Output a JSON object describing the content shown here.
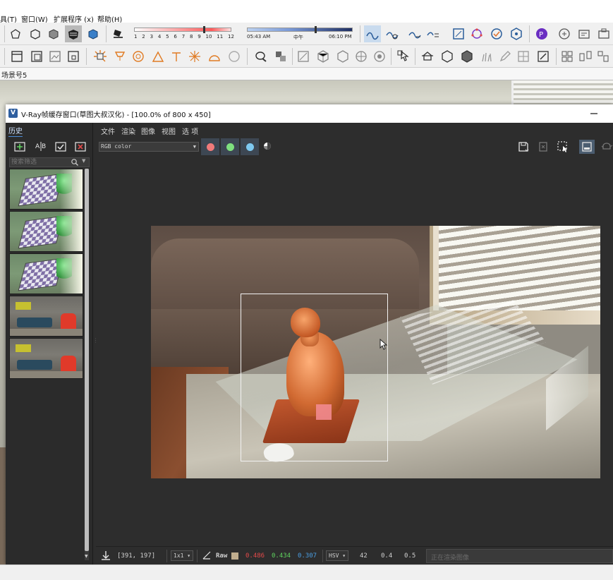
{
  "sketchup": {
    "menus": [
      {
        "id": "tools",
        "label": "具(T)"
      },
      {
        "id": "window",
        "label": "窗口(W)"
      },
      {
        "id": "extensions",
        "label": "扩展程序 (x)"
      },
      {
        "id": "help",
        "label": "帮助(H)"
      }
    ],
    "shadow_months": [
      "1",
      "2",
      "3",
      "4",
      "5",
      "6",
      "7",
      "8",
      "9",
      "10",
      "11",
      "12"
    ],
    "shadow_time_start": "05:43 AM",
    "shadow_time_mid": "中午",
    "shadow_time_end": "06:10 PM",
    "scene_tab": "场景号5"
  },
  "vfb": {
    "title": "V-Ray帧缓存窗口(草图大叔汉化) - [100.0% of 800 x 450]",
    "logo_glyph": "V",
    "history_label": "历史",
    "search_placeholder": "搜索筛选",
    "menus": [
      {
        "id": "file",
        "label": "文件"
      },
      {
        "id": "render",
        "label": "渲染"
      },
      {
        "id": "image",
        "label": "图像"
      },
      {
        "id": "view",
        "label": "视图"
      },
      {
        "id": "options",
        "label": "选 项"
      }
    ],
    "channel": "RGB color",
    "channel_colors": {
      "red": "#f07a7a",
      "green": "#7ee07e",
      "blue": "#7ec9f0"
    },
    "history_thumbs": [
      {
        "kind": "tex"
      },
      {
        "kind": "tex"
      },
      {
        "kind": "tex"
      },
      {
        "kind": "room"
      },
      {
        "kind": "room"
      }
    ],
    "status": {
      "coords": "[391, 197]",
      "sample_size": "1x1",
      "mode": "Raw",
      "r": "0.486",
      "g": "0.434",
      "b": "0.307",
      "color_space": "HSV",
      "h": "42",
      "s": "0.4",
      "v": "0.5",
      "progress_text": "正在渲染图像",
      "colors": {
        "r": "#e24a4a",
        "g": "#5fd35f",
        "b": "#4a9ee2",
        "swatch": "#c0ad8e"
      }
    }
  }
}
